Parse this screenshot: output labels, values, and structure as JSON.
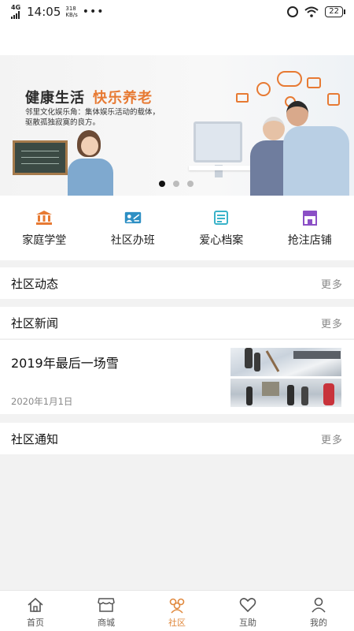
{
  "status_bar": {
    "network": "4G",
    "time": "14:05",
    "speed_value": "318",
    "speed_unit": "KB/s",
    "more": "•••",
    "battery": "22"
  },
  "banner": {
    "title_part1": "健康生活",
    "title_part2": "快乐养老",
    "desc_line1": "邻里文化娱乐角：集体娱乐活动的载体，",
    "desc_line2": "驱散孤独寂寞的良方。",
    "pager_count": 3,
    "pager_active": 0,
    "accent_color": "#e77a33"
  },
  "quick_nav": [
    {
      "label": "家庭学堂",
      "icon": "institution-icon",
      "color": "#e77a33"
    },
    {
      "label": "社区办班",
      "icon": "classroom-icon",
      "color": "#2d8fc4"
    },
    {
      "label": "爱心档案",
      "icon": "profile-card-icon",
      "color": "#3ab3c9"
    },
    {
      "label": "抢注店铺",
      "icon": "store-icon",
      "color": "#8b4fc6"
    }
  ],
  "sections": {
    "dynamics": {
      "title": "社区动态",
      "more": "更多"
    },
    "news": {
      "title": "社区新闻",
      "more": "更多"
    },
    "notice": {
      "title": "社区通知",
      "more": "更多"
    }
  },
  "news_items": [
    {
      "title": "2019年最后一场雪",
      "date": "2020年1月1日"
    }
  ],
  "bottom_tabs": [
    {
      "label": "首页",
      "icon": "home-icon",
      "active": false
    },
    {
      "label": "商城",
      "icon": "shop-icon",
      "active": false
    },
    {
      "label": "社区",
      "icon": "community-icon",
      "active": true
    },
    {
      "label": "互助",
      "icon": "heart-icon",
      "active": false
    },
    {
      "label": "我的",
      "icon": "user-icon",
      "active": false
    }
  ],
  "colors": {
    "active_tab": "#e0893e",
    "background": "#f2f2f2"
  }
}
